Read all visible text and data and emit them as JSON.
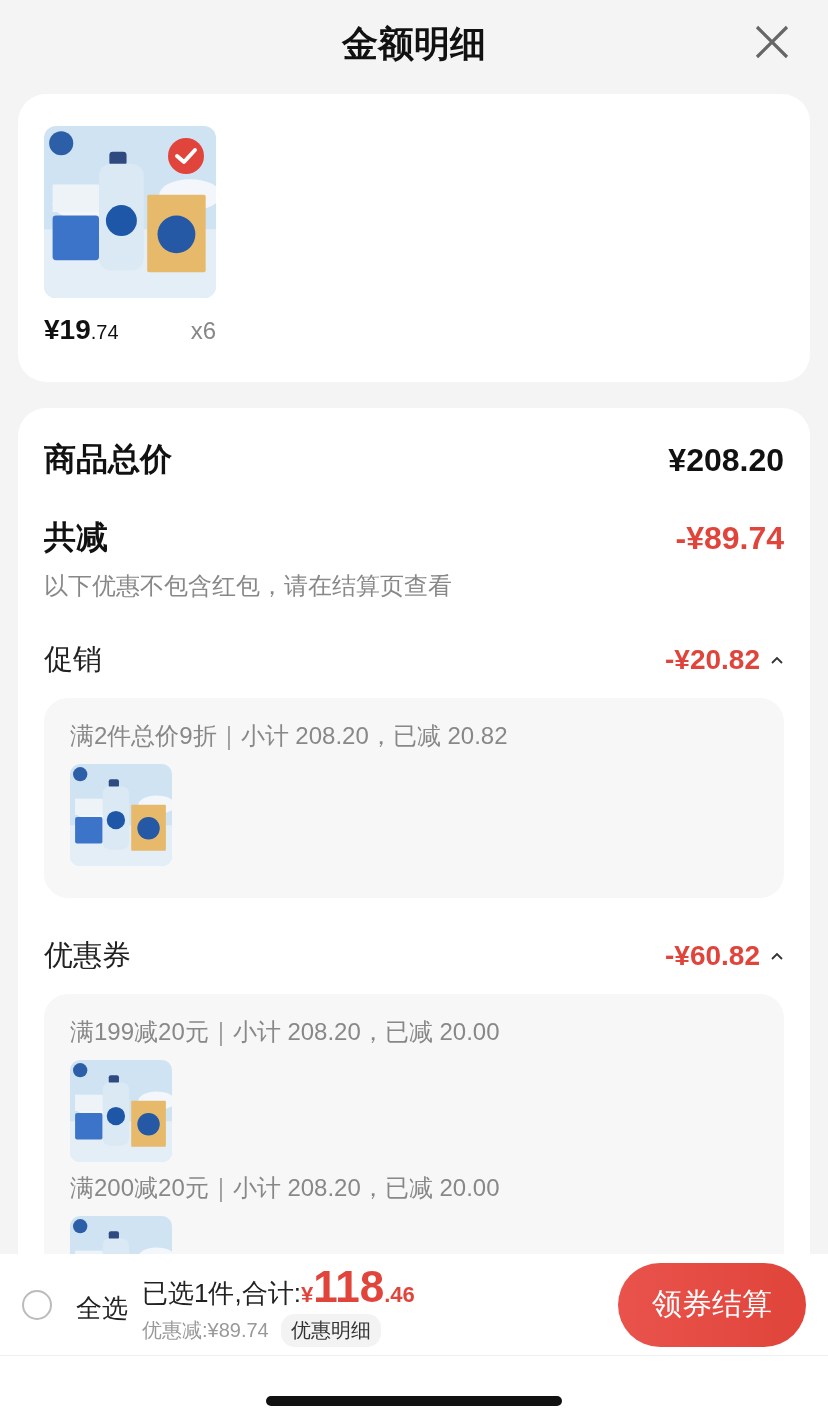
{
  "title": "金额明细",
  "product": {
    "selected": true,
    "price_integer": "¥19",
    "price_decimal": ".74",
    "quantity": "x6"
  },
  "summary": {
    "total_label": "商品总价",
    "total_value": "¥208.20",
    "discount_label": "共减",
    "discount_value": "-¥89.74",
    "note": "以下优惠不包含红包，请在结算页查看"
  },
  "sections": [
    {
      "label": "促销",
      "amount": "-¥20.82",
      "expanded": true,
      "rules": [
        {
          "text": "满2件总价9折｜小计 208.20，已减 20.82"
        }
      ]
    },
    {
      "label": "优惠券",
      "amount": "-¥60.82",
      "expanded": true,
      "rules": [
        {
          "text": "满199减20元｜小计 208.20，已减 20.00"
        },
        {
          "text": "满200减20元｜小计 208.20，已减 20.00"
        }
      ]
    }
  ],
  "bottom_bar": {
    "select_all": {
      "label": "全选",
      "checked": false
    },
    "selected_count": "已选1件,合计:",
    "currency": "¥",
    "total_integer": "118",
    "total_decimal": ".46",
    "discount": "优惠减:¥89.74",
    "detail_button": "优惠明细",
    "checkout_button": "领券结算"
  }
}
